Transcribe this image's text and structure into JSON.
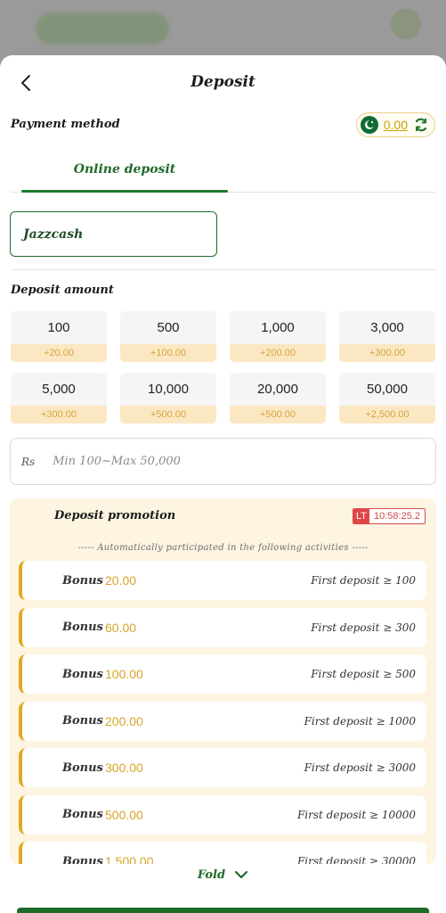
{
  "header": {
    "title": "Deposit"
  },
  "payment": {
    "label": "Payment method",
    "balance": "0.00",
    "flag_color": "#0f6b33"
  },
  "tabs": [
    {
      "label": "Online deposit",
      "active": true
    }
  ],
  "method": {
    "name": "Jazzcash"
  },
  "deposit": {
    "label": "Deposit amount",
    "options": [
      {
        "amount": "100",
        "bonus": "+20.00"
      },
      {
        "amount": "500",
        "bonus": "+100.00"
      },
      {
        "amount": "1,000",
        "bonus": "+200.00"
      },
      {
        "amount": "3,000",
        "bonus": "+300.00"
      },
      {
        "amount": "5,000",
        "bonus": "+300.00"
      },
      {
        "amount": "10,000",
        "bonus": "+500.00"
      },
      {
        "amount": "20,000",
        "bonus": "+500.00"
      },
      {
        "amount": "50,000",
        "bonus": "+2,500.00"
      }
    ],
    "currency": "Rs",
    "placeholder": "Min 100~Max 50,000"
  },
  "promotion": {
    "title": "Deposit promotion",
    "timer_zone": "LT",
    "timer": "10:58:25.2",
    "note": "----- Automatically participated in the following activities -----",
    "items": [
      {
        "label": "Bonus",
        "value": "20.00",
        "condition": "First deposit ≥ 100"
      },
      {
        "label": "Bonus",
        "value": "60.00",
        "condition": "First deposit ≥ 300"
      },
      {
        "label": "Bonus",
        "value": "100.00",
        "condition": "First deposit ≥ 500"
      },
      {
        "label": "Bonus",
        "value": "200.00",
        "condition": "First deposit ≥ 1000"
      },
      {
        "label": "Bonus",
        "value": "300.00",
        "condition": "First deposit ≥ 3000"
      },
      {
        "label": "Bonus",
        "value": "500.00",
        "condition": "First deposit ≥ 10000"
      },
      {
        "label": "Bonus",
        "value": "1,500.00",
        "condition": "First deposit ≥ 30000"
      }
    ]
  },
  "fold": {
    "label": "Fold"
  },
  "colors": {
    "primary": "#1f6b2a",
    "gold": "#d6a42a",
    "promo_bg": "#fdf4e2"
  }
}
